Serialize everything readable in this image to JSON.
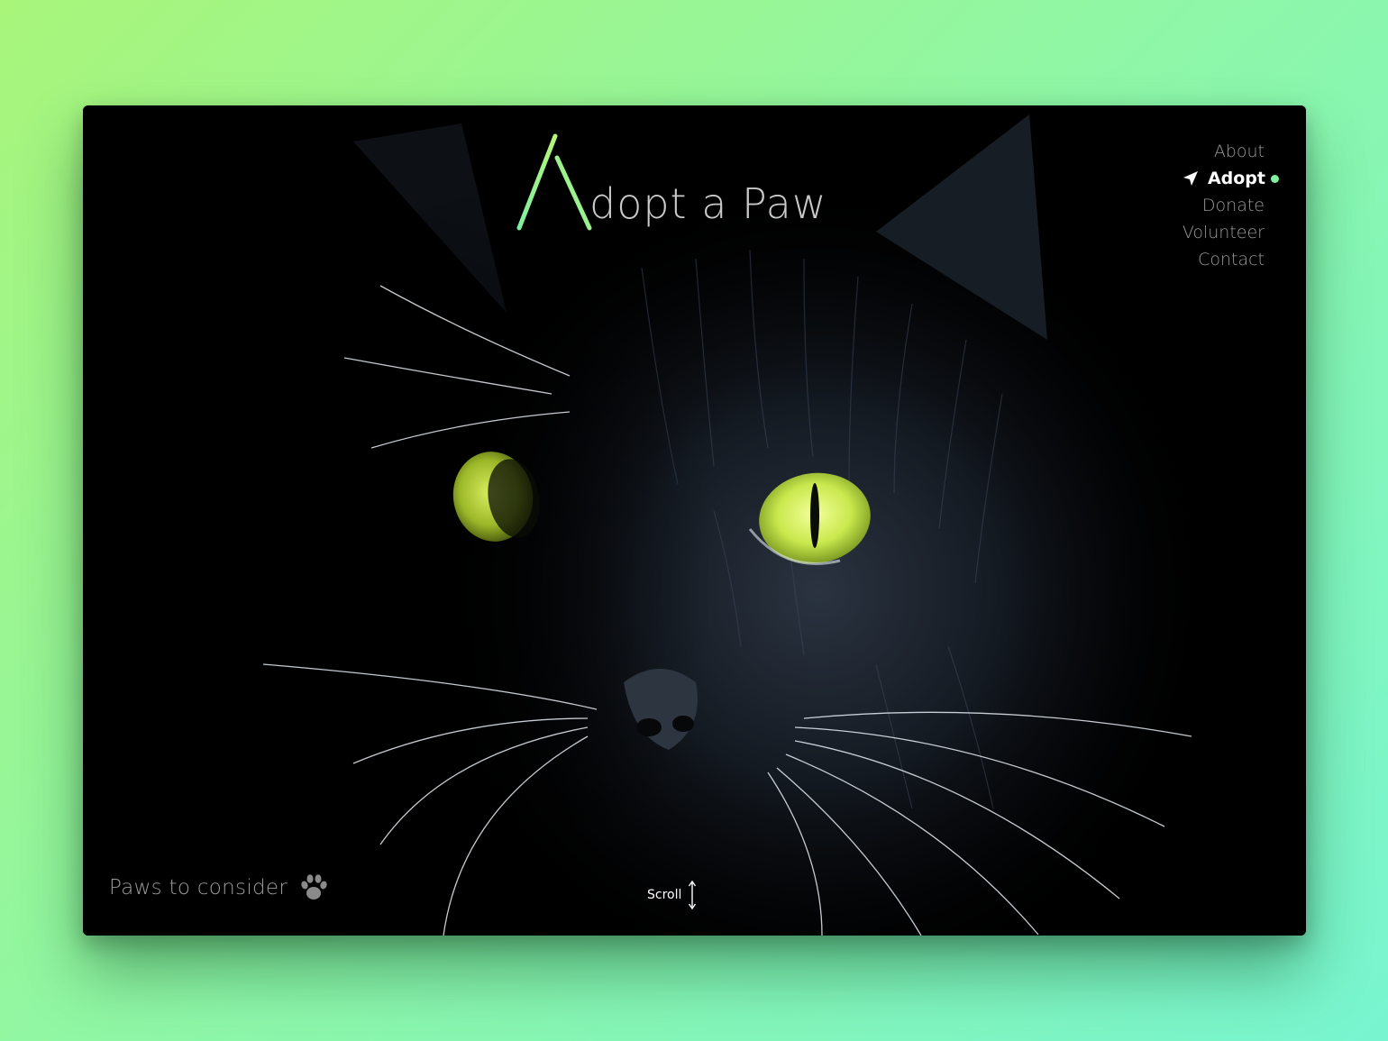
{
  "colors": {
    "background_start": "#a8f57a",
    "background_end": "#78f5d0",
    "accent": "#7ff0a0",
    "eye": "#d8f26a"
  },
  "brand": {
    "mark_icon": "a-chevron-logo-icon",
    "text": "dopt a Paw"
  },
  "nav": {
    "items": [
      {
        "label": "About",
        "active": false
      },
      {
        "label": "Adopt",
        "active": true
      },
      {
        "label": "Donate",
        "active": false
      },
      {
        "label": "Volunteer",
        "active": false
      },
      {
        "label": "Contact",
        "active": false
      }
    ],
    "active_icon": "navigation-arrow-icon",
    "active_indicator": "dot-indicator"
  },
  "hero": {
    "image": "black-cat-face-photo"
  },
  "footer": {
    "tagline": "Paws to consider",
    "tagline_icon": "paw-icon",
    "scroll_label": "Scroll",
    "scroll_icon": "vertical-arrows-icon"
  }
}
